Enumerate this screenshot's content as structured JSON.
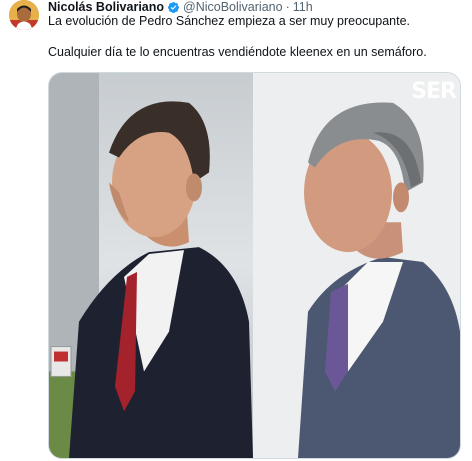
{
  "tweet": {
    "author_name": "Nicolás Bolivariano",
    "handle": "@NicoBolivariano",
    "separator": "·",
    "time": "11h",
    "text_line_1": "La evolución de Pedro Sánchez empieza a ser muy preocupante.",
    "text_line_2": "Cualquier día te lo encuentras vendiéndote kleenex en un semáforo.",
    "verified_icon": "verified-badge-icon",
    "accent_color": "#1d9bf0"
  },
  "media": {
    "watermark": "SER",
    "left_photo": "Man in dark suit with red tie, profile",
    "right_photo": "Gray-haired man in gray suit with purple tie, profile"
  }
}
